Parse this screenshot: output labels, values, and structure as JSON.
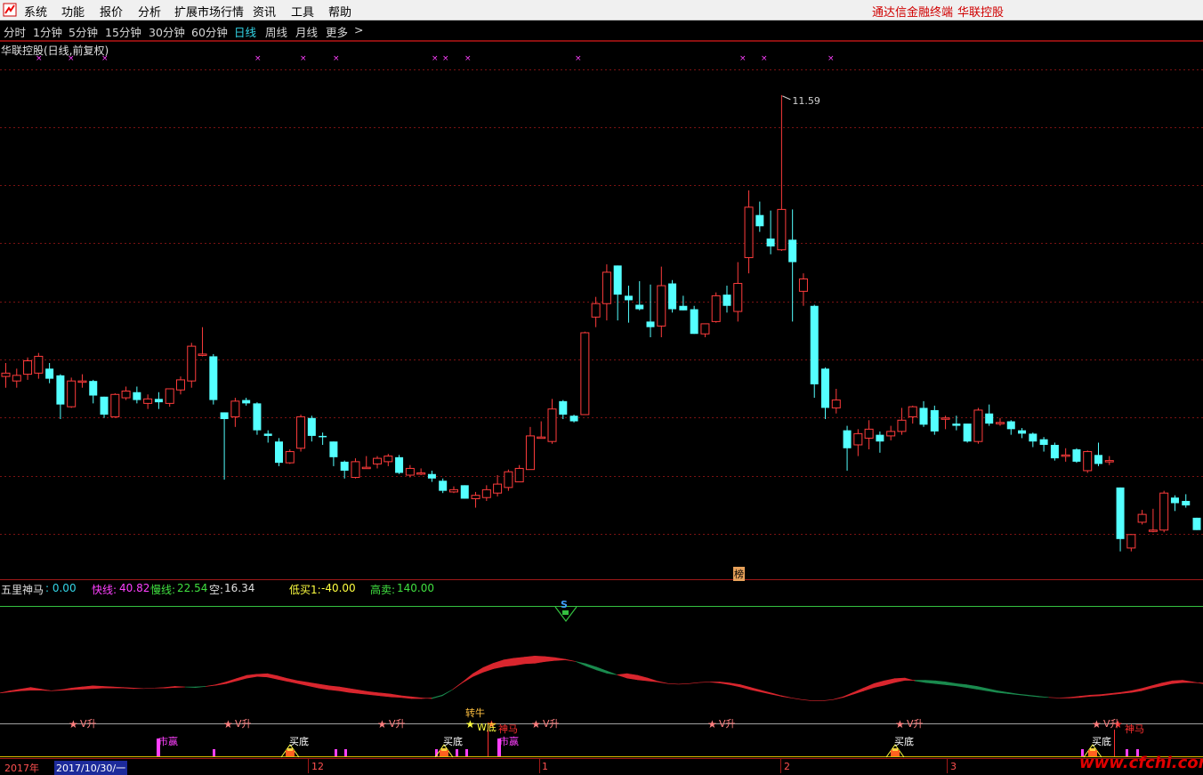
{
  "menu": {
    "items": [
      "系统",
      "功能",
      "报价",
      "分析",
      "扩展市场行情",
      "资讯",
      "工具",
      "帮助"
    ],
    "right_product": "通达信金融终端",
    "right_stock": "华联控股"
  },
  "periods": {
    "items": [
      "分时",
      "1分钟",
      "5分钟",
      "15分钟",
      "30分钟",
      "60分钟",
      "日线",
      "周线",
      "月线",
      "更多"
    ],
    "active": "日线",
    "more_arrow": ">"
  },
  "price_panel": {
    "title": "华联控股(日线,前复权)",
    "high_label": "11.59",
    "bang_label": "榜"
  },
  "indicator": {
    "name": "五里神马",
    "name_value": ": 0.00",
    "fast_label": "快线:",
    "fast_value": "40.82",
    "slow_label": "慢线:",
    "slow_value": "22.54",
    "empty_label": "空:",
    "empty_value": "16.34",
    "lowbuy_label": "低买1:",
    "lowbuy_value": "-40.00",
    "highsell_label": "高卖:",
    "highsell_value": "140.00",
    "s_mark": "S",
    "v_up_label": "V升",
    "niu_label": "转牛",
    "w_label": "W底",
    "shenma_label": "神马",
    "shixiao_label": "市赢",
    "buy_bottom_label": "买底"
  },
  "timeline": {
    "year": "2017年",
    "date_cursor": "2017/10/30/一",
    "months": [
      "12",
      "1",
      "2",
      "3"
    ]
  },
  "watermark": "www.cfchi.com",
  "colors": {
    "bull": "#ff3c3c",
    "bear": "#54ffff",
    "grid": "#7a1212",
    "magenta": "#ff40ff",
    "fill_red": "#d9262e",
    "fill_green": "#1a8a4e",
    "watermark_red": "#e00000"
  },
  "chart_data": {
    "type": "candlestick",
    "price_range": [
      7.2,
      11.95
    ],
    "candles": [
      {
        "o": 9.08,
        "c": 9.11,
        "h": 9.2,
        "l": 8.98
      },
      {
        "o": 9.04,
        "c": 9.09,
        "h": 9.15,
        "l": 8.98
      },
      {
        "o": 9.1,
        "c": 9.22,
        "h": 9.25,
        "l": 9.05
      },
      {
        "o": 9.11,
        "c": 9.26,
        "h": 9.29,
        "l": 9.06
      },
      {
        "o": 9.15,
        "c": 9.06,
        "h": 9.2,
        "l": 9.02
      },
      {
        "o": 9.09,
        "c": 8.83,
        "h": 9.1,
        "l": 8.7
      },
      {
        "o": 8.81,
        "c": 9.04,
        "h": 9.07,
        "l": 8.8
      },
      {
        "o": 9.04,
        "c": 9.04,
        "h": 9.1,
        "l": 8.98
      },
      {
        "o": 9.04,
        "c": 8.91,
        "h": 9.05,
        "l": 8.84
      },
      {
        "o": 8.9,
        "c": 8.74,
        "h": 8.9,
        "l": 8.71
      },
      {
        "o": 8.72,
        "c": 8.92,
        "h": 8.93,
        "l": 8.71
      },
      {
        "o": 8.89,
        "c": 8.95,
        "h": 8.99,
        "l": 8.87
      },
      {
        "o": 8.94,
        "c": 8.87,
        "h": 8.99,
        "l": 8.84
      },
      {
        "o": 8.84,
        "c": 8.88,
        "h": 8.92,
        "l": 8.79
      },
      {
        "o": 8.88,
        "c": 8.85,
        "h": 8.94,
        "l": 8.79
      },
      {
        "o": 8.84,
        "c": 8.97,
        "h": 8.97,
        "l": 8.81
      },
      {
        "o": 8.96,
        "c": 9.05,
        "h": 9.08,
        "l": 8.92
      },
      {
        "o": 9.04,
        "c": 9.35,
        "h": 9.38,
        "l": 8.98
      },
      {
        "o": 9.28,
        "c": 9.28,
        "h": 9.52,
        "l": 9.26
      },
      {
        "o": 9.26,
        "c": 8.87,
        "h": 9.28,
        "l": 8.83
      },
      {
        "o": 8.76,
        "c": 8.7,
        "h": 8.76,
        "l": 8.16
      },
      {
        "o": 8.72,
        "c": 8.86,
        "h": 8.89,
        "l": 8.63
      },
      {
        "o": 8.87,
        "c": 8.84,
        "h": 8.89,
        "l": 8.82
      },
      {
        "o": 8.84,
        "c": 8.6,
        "h": 8.85,
        "l": 8.56
      },
      {
        "o": 8.57,
        "c": 8.55,
        "h": 8.6,
        "l": 8.49
      },
      {
        "o": 8.5,
        "c": 8.31,
        "h": 8.53,
        "l": 8.28
      },
      {
        "o": 8.31,
        "c": 8.41,
        "h": 8.43,
        "l": 8.3
      },
      {
        "o": 8.44,
        "c": 8.72,
        "h": 8.74,
        "l": 8.41
      },
      {
        "o": 8.71,
        "c": 8.55,
        "h": 8.73,
        "l": 8.5
      },
      {
        "o": 8.55,
        "c": 8.54,
        "h": 8.58,
        "l": 8.47
      },
      {
        "o": 8.5,
        "c": 8.36,
        "h": 8.5,
        "l": 8.28
      },
      {
        "o": 8.32,
        "c": 8.24,
        "h": 8.33,
        "l": 8.17
      },
      {
        "o": 8.18,
        "c": 8.32,
        "h": 8.35,
        "l": 8.17
      },
      {
        "o": 8.27,
        "c": 8.27,
        "h": 8.37,
        "l": 8.27
      },
      {
        "o": 8.3,
        "c": 8.35,
        "h": 8.37,
        "l": 8.26
      },
      {
        "o": 8.32,
        "c": 8.37,
        "h": 8.39,
        "l": 8.28
      },
      {
        "o": 8.36,
        "c": 8.22,
        "h": 8.38,
        "l": 8.21
      },
      {
        "o": 8.2,
        "c": 8.26,
        "h": 8.29,
        "l": 8.18
      },
      {
        "o": 8.22,
        "c": 8.22,
        "h": 8.26,
        "l": 8.2
      },
      {
        "o": 8.21,
        "c": 8.17,
        "h": 8.24,
        "l": 8.14
      },
      {
        "o": 8.15,
        "c": 8.06,
        "h": 8.17,
        "l": 8.04
      },
      {
        "o": 8.05,
        "c": 8.07,
        "h": 8.1,
        "l": 8.04
      },
      {
        "o": 8.11,
        "c": 7.99,
        "h": 8.11,
        "l": 7.99
      },
      {
        "o": 7.99,
        "c": 8.02,
        "h": 8.05,
        "l": 7.91
      },
      {
        "o": 8.0,
        "c": 8.07,
        "h": 8.11,
        "l": 7.97
      },
      {
        "o": 8.04,
        "c": 8.12,
        "h": 8.2,
        "l": 8.01
      },
      {
        "o": 8.09,
        "c": 8.23,
        "h": 8.25,
        "l": 8.06
      },
      {
        "o": 8.14,
        "c": 8.26,
        "h": 8.29,
        "l": 8.14
      },
      {
        "o": 8.25,
        "c": 8.55,
        "h": 8.63,
        "l": 8.25
      },
      {
        "o": 8.54,
        "c": 8.54,
        "h": 8.68,
        "l": 8.54
      },
      {
        "o": 8.5,
        "c": 8.79,
        "h": 8.88,
        "l": 8.48
      },
      {
        "o": 8.86,
        "c": 8.74,
        "h": 8.87,
        "l": 8.7
      },
      {
        "o": 8.73,
        "c": 8.68,
        "h": 8.74,
        "l": 8.67
      },
      {
        "o": 8.74,
        "c": 9.47,
        "h": 9.48,
        "l": 8.74
      },
      {
        "o": 9.61,
        "c": 9.73,
        "h": 9.79,
        "l": 9.52
      },
      {
        "o": 9.73,
        "c": 10.01,
        "h": 10.08,
        "l": 9.58
      },
      {
        "o": 10.07,
        "c": 9.81,
        "h": 10.07,
        "l": 9.58
      },
      {
        "o": 9.8,
        "c": 9.76,
        "h": 9.89,
        "l": 9.56
      },
      {
        "o": 9.72,
        "c": 9.68,
        "h": 9.93,
        "l": 9.67
      },
      {
        "o": 9.57,
        "c": 9.52,
        "h": 9.9,
        "l": 9.43
      },
      {
        "o": 9.53,
        "c": 9.89,
        "h": 10.06,
        "l": 9.43
      },
      {
        "o": 9.91,
        "c": 9.68,
        "h": 9.94,
        "l": 9.65
      },
      {
        "o": 9.71,
        "c": 9.67,
        "h": 9.8,
        "l": 9.67
      },
      {
        "o": 9.68,
        "c": 9.46,
        "h": 9.71,
        "l": 9.46
      },
      {
        "o": 9.46,
        "c": 9.55,
        "h": 9.55,
        "l": 9.43
      },
      {
        "o": 9.57,
        "c": 9.8,
        "h": 9.83,
        "l": 9.56
      },
      {
        "o": 9.81,
        "c": 9.71,
        "h": 9.89,
        "l": 9.65
      },
      {
        "o": 9.66,
        "c": 9.91,
        "h": 10.1,
        "l": 9.57
      },
      {
        "o": 10.14,
        "c": 10.59,
        "h": 10.74,
        "l": 10.0
      },
      {
        "o": 10.52,
        "c": 10.42,
        "h": 10.64,
        "l": 10.37
      },
      {
        "o": 10.31,
        "c": 10.24,
        "h": 10.56,
        "l": 10.17
      },
      {
        "o": 10.21,
        "c": 10.57,
        "h": 11.59,
        "l": 10.2
      },
      {
        "o": 10.3,
        "c": 10.1,
        "h": 10.57,
        "l": 9.57
      },
      {
        "o": 9.84,
        "c": 9.95,
        "h": 10.0,
        "l": 9.71
      },
      {
        "o": 9.71,
        "c": 9.01,
        "h": 9.72,
        "l": 8.89
      },
      {
        "o": 9.15,
        "c": 8.8,
        "h": 9.16,
        "l": 8.7
      },
      {
        "o": 8.8,
        "c": 8.87,
        "h": 8.97,
        "l": 8.75
      },
      {
        "o": 8.6,
        "c": 8.44,
        "h": 8.64,
        "l": 8.24
      },
      {
        "o": 8.47,
        "c": 8.57,
        "h": 8.61,
        "l": 8.37
      },
      {
        "o": 8.53,
        "c": 8.61,
        "h": 8.69,
        "l": 8.43
      },
      {
        "o": 8.56,
        "c": 8.5,
        "h": 8.59,
        "l": 8.4
      },
      {
        "o": 8.55,
        "c": 8.59,
        "h": 8.64,
        "l": 8.51
      },
      {
        "o": 8.59,
        "c": 8.69,
        "h": 8.8,
        "l": 8.56
      },
      {
        "o": 8.72,
        "c": 8.81,
        "h": 8.82,
        "l": 8.66
      },
      {
        "o": 8.8,
        "c": 8.65,
        "h": 8.86,
        "l": 8.63
      },
      {
        "o": 8.78,
        "c": 8.59,
        "h": 8.82,
        "l": 8.56
      },
      {
        "o": 8.7,
        "c": 8.71,
        "h": 8.73,
        "l": 8.61
      },
      {
        "o": 8.66,
        "c": 8.64,
        "h": 8.73,
        "l": 8.6
      },
      {
        "o": 8.66,
        "c": 8.5,
        "h": 8.66,
        "l": 8.49
      },
      {
        "o": 8.5,
        "c": 8.78,
        "h": 8.8,
        "l": 8.48
      },
      {
        "o": 8.75,
        "c": 8.66,
        "h": 8.83,
        "l": 8.64
      },
      {
        "o": 8.66,
        "c": 8.67,
        "h": 8.71,
        "l": 8.64
      },
      {
        "o": 8.68,
        "c": 8.61,
        "h": 8.69,
        "l": 8.56
      },
      {
        "o": 8.6,
        "c": 8.57,
        "h": 8.62,
        "l": 8.53
      },
      {
        "o": 8.57,
        "c": 8.5,
        "h": 8.58,
        "l": 8.45
      },
      {
        "o": 8.52,
        "c": 8.47,
        "h": 8.54,
        "l": 8.41
      },
      {
        "o": 8.47,
        "c": 8.35,
        "h": 8.49,
        "l": 8.33
      },
      {
        "o": 8.38,
        "c": 8.38,
        "h": 8.44,
        "l": 8.32
      },
      {
        "o": 8.43,
        "c": 8.32,
        "h": 8.44,
        "l": 8.31
      },
      {
        "o": 8.24,
        "c": 8.41,
        "h": 8.42,
        "l": 8.22
      },
      {
        "o": 8.38,
        "c": 8.3,
        "h": 8.49,
        "l": 8.28
      },
      {
        "o": 8.33,
        "c": 8.33,
        "h": 8.37,
        "l": 8.29
      },
      {
        "o": 8.09,
        "c": 7.63,
        "h": 8.09,
        "l": 7.52
      },
      {
        "o": 7.55,
        "c": 7.67,
        "h": 7.67,
        "l": 7.52
      },
      {
        "o": 7.78,
        "c": 7.85,
        "h": 7.89,
        "l": 7.76
      },
      {
        "o": 7.71,
        "c": 7.71,
        "h": 7.9,
        "l": 7.69
      },
      {
        "o": 7.71,
        "c": 8.04,
        "h": 8.06,
        "l": 7.69
      },
      {
        "o": 8.0,
        "c": 7.95,
        "h": 8.02,
        "l": 7.88
      },
      {
        "o": 7.97,
        "c": 7.93,
        "h": 8.03,
        "l": 7.91
      },
      {
        "o": 7.82,
        "c": 7.71,
        "h": 7.82,
        "l": 7.71
      }
    ],
    "fast": [
      18,
      22,
      25,
      28,
      25,
      22,
      24,
      27,
      29,
      31,
      30,
      29,
      28,
      27,
      26,
      27,
      28,
      30,
      29,
      28,
      30,
      33,
      38,
      44,
      50,
      52,
      53,
      49,
      44,
      40,
      37,
      34,
      31,
      29,
      26,
      23,
      20,
      18,
      16,
      13,
      11,
      9,
      8,
      13,
      24,
      38,
      53,
      64,
      72,
      78,
      81,
      83,
      85,
      84,
      82,
      79,
      75,
      67,
      60,
      54,
      51,
      53,
      50,
      45,
      39,
      35,
      34,
      35,
      37,
      38,
      38,
      36,
      33,
      28,
      23,
      18,
      13,
      9,
      6,
      4,
      4,
      6,
      11,
      19,
      27,
      35,
      40,
      44,
      45,
      40,
      37,
      35,
      33,
      31,
      28,
      25,
      22,
      19,
      17,
      15,
      13,
      11,
      10,
      9,
      10,
      12,
      14,
      15,
      17,
      19,
      22,
      26,
      31,
      36,
      40,
      41,
      38,
      35
    ],
    "slow": [
      18,
      20,
      22,
      23,
      23,
      22,
      23,
      24,
      25,
      26,
      27,
      27,
      27,
      26,
      26,
      27,
      27,
      28,
      29,
      29,
      30,
      32,
      35,
      40,
      45,
      48,
      47,
      43,
      39,
      35,
      31,
      27,
      24,
      22,
      19,
      17,
      15,
      13,
      11,
      10,
      8,
      8,
      9,
      14,
      24,
      37,
      48,
      56,
      62,
      66,
      68,
      71,
      72,
      75,
      77,
      78,
      75,
      71,
      65,
      58,
      51,
      45,
      42,
      40,
      38,
      35,
      34,
      35,
      37,
      38,
      36,
      33,
      29,
      24,
      20,
      16,
      12,
      9,
      6,
      4,
      4,
      6,
      10,
      16,
      22,
      28,
      32,
      37,
      41,
      41,
      41,
      40,
      38,
      35,
      33,
      30,
      26,
      22,
      19,
      16,
      14,
      12,
      10,
      9,
      9,
      10,
      12,
      13,
      15,
      17,
      19,
      22,
      27,
      31,
      35,
      37,
      37,
      36
    ]
  }
}
